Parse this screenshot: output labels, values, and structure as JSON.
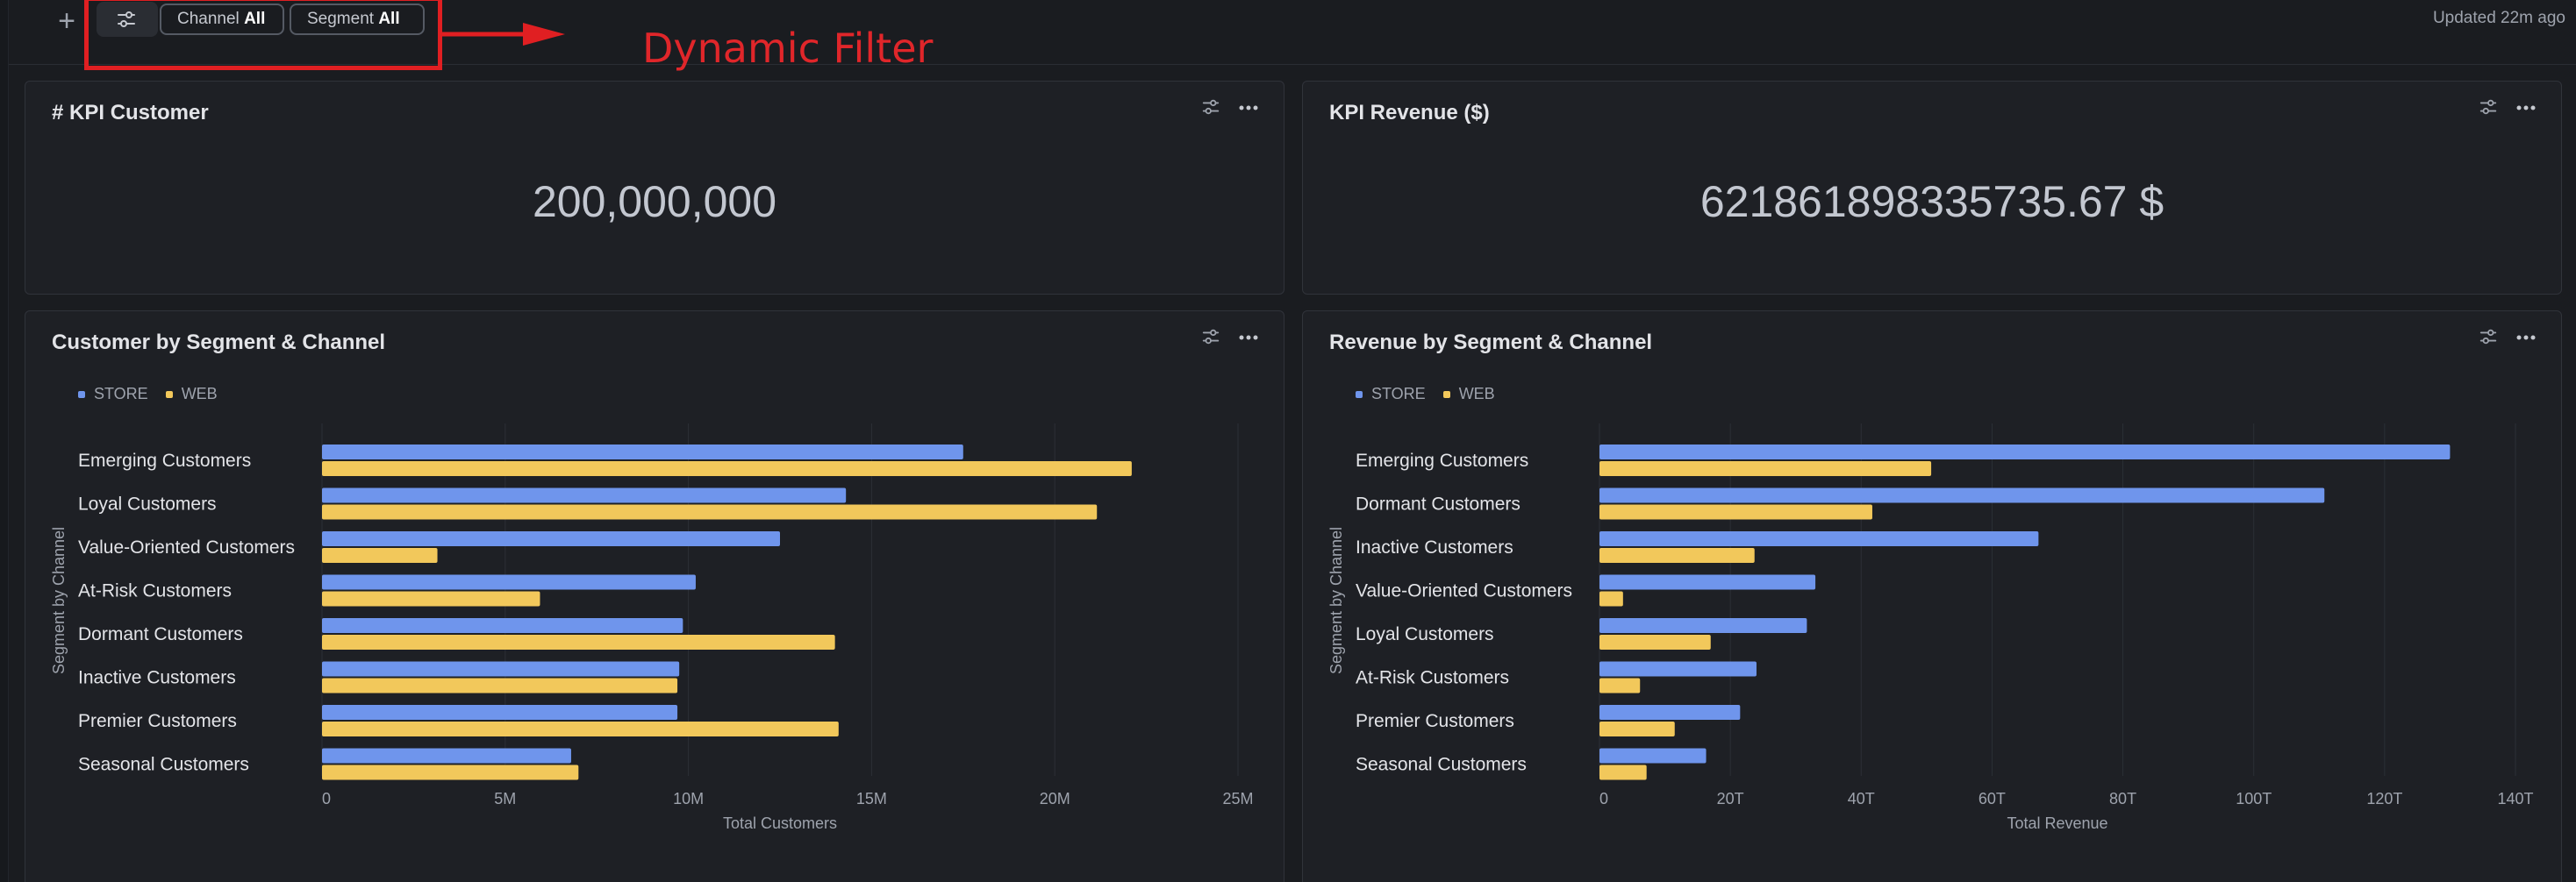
{
  "toolbar": {
    "add_icon": "plus-icon",
    "filter_icon": "sliders-icon",
    "filters": [
      {
        "label": "Channel",
        "value": "All"
      },
      {
        "label": "Segment",
        "value": "All"
      }
    ],
    "updated": "Updated 22m ago"
  },
  "annotation": {
    "text": "Dynamic Filter",
    "color": "#e0262a"
  },
  "colors": {
    "store": "#6f95ec",
    "web": "#f2c85b",
    "background": "#1a1c20",
    "card": "#1e2025"
  },
  "cards": {
    "kpi_customer": {
      "title": "# KPI Customer",
      "value": "200,000,000"
    },
    "kpi_revenue": {
      "title": "KPI Revenue ($)",
      "value": "621861898335735.67 $"
    },
    "customer_chart": {
      "title": "Customer by Segment & Channel"
    },
    "revenue_chart": {
      "title": "Revenue by Segment & Channel"
    }
  },
  "chart_data": [
    {
      "type": "bar",
      "orientation": "horizontal",
      "title": "Customer by Segment & Channel",
      "xlabel": "Total Customers",
      "ylabel": "Segment by Channel",
      "categories": [
        "Emerging Customers",
        "Loyal Customers",
        "Value-Oriented Customers",
        "At-Risk Customers",
        "Dormant Customers",
        "Inactive Customers",
        "Premier Customers",
        "Seasonal Customers"
      ],
      "series": [
        {
          "name": "STORE",
          "values": [
            17500000,
            14300000,
            12500000,
            10200000,
            9850000,
            9750000,
            9700000,
            6800000
          ]
        },
        {
          "name": "WEB",
          "values": [
            22100000,
            21150000,
            3150000,
            5950000,
            14000000,
            9700000,
            14100000,
            7000000
          ]
        }
      ],
      "xlim": [
        0,
        25000000
      ],
      "ticks": [
        "0",
        "5M",
        "10M",
        "15M",
        "20M",
        "25M"
      ],
      "tick_values": [
        0,
        5000000,
        10000000,
        15000000,
        20000000,
        25000000
      ],
      "legend": "top-left",
      "grid": "vertical"
    },
    {
      "type": "bar",
      "orientation": "horizontal",
      "title": "Revenue by Segment & Channel",
      "xlabel": "Total Revenue",
      "ylabel": "Segment by Channel",
      "categories": [
        "Emerging Customers",
        "Dormant Customers",
        "Inactive Customers",
        "Value-Oriented Customers",
        "Loyal Customers",
        "At-Risk Customers",
        "Premier Customers",
        "Seasonal Customers"
      ],
      "series": [
        {
          "name": "STORE",
          "values": [
            130000000000000,
            110800000000000,
            67100000000000,
            33000000000000,
            31700000000000,
            24000000000000,
            21500000000000,
            16300000000000
          ]
        },
        {
          "name": "WEB",
          "values": [
            50700000000000,
            41700000000000,
            23700000000000,
            3600000000000,
            17000000000000,
            6200000000000,
            11500000000000,
            7200000000000
          ]
        }
      ],
      "xlim": [
        0,
        140000000000000
      ],
      "ticks": [
        "0",
        "20T",
        "40T",
        "60T",
        "80T",
        "100T",
        "120T",
        "140T"
      ],
      "tick_values": [
        0,
        20000000000000,
        40000000000000,
        60000000000000,
        80000000000000,
        100000000000000,
        120000000000000,
        140000000000000
      ],
      "legend": "top-left",
      "grid": "vertical"
    }
  ]
}
